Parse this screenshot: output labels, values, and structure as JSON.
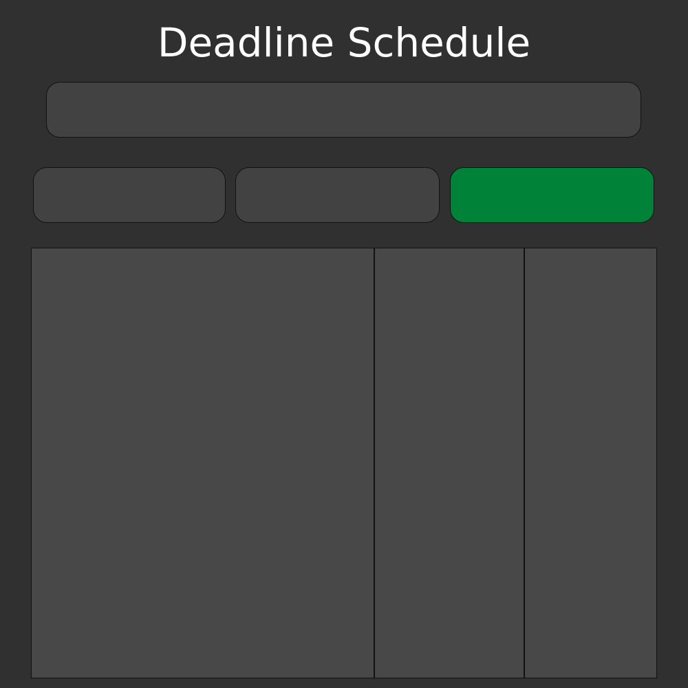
{
  "page": {
    "title": "Deadline Schedule"
  },
  "input": {
    "value": "",
    "placeholder": ""
  },
  "buttons": [
    {
      "label": ""
    },
    {
      "label": ""
    },
    {
      "label": ""
    }
  ],
  "table": {
    "columns": [
      {
        "header": ""
      },
      {
        "header": ""
      },
      {
        "header": ""
      }
    ]
  },
  "colors": {
    "background": "#303030",
    "control": "#424242",
    "table": "#484848",
    "accent": "#008339",
    "text": "#ffffff"
  }
}
